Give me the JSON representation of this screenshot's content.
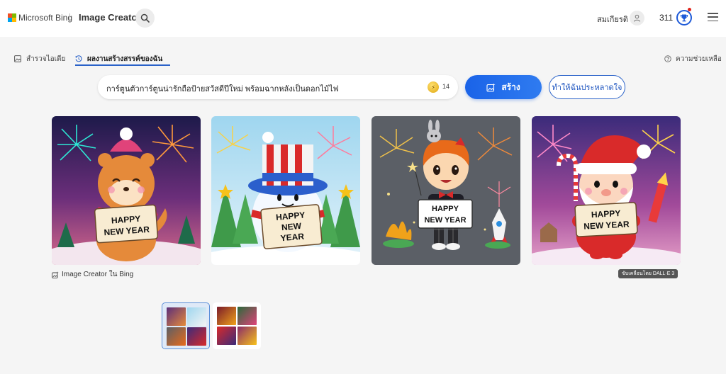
{
  "header": {
    "brand": "Microsoft Bing",
    "app_title": "Image Creator",
    "user_name": "สมเกียรติ",
    "points": "311"
  },
  "tabs": [
    {
      "label": "สำรวจไอเดีย",
      "icon": "image-icon",
      "active": false
    },
    {
      "label": "ผลงานสร้างสรรค์ของฉัน",
      "icon": "history-icon",
      "active": true
    }
  ],
  "help_label": "ความช่วยเหลือ",
  "prompt": {
    "value": "การ์ตูนตัวการ์ตูนน่ารักถือป้ายสวัสดีปีใหม่ พร้อมฉากหลังเป็นดอกไม้ไฟ",
    "boosts": "14"
  },
  "buttons": {
    "create_label": "สร้าง",
    "surprise_label": "ทำให้ฉันประหลาดใจ"
  },
  "images": [
    {
      "sign": [
        "HAPPY",
        "NEW YEAR"
      ],
      "subject": "fox-character"
    },
    {
      "sign": [
        "HAPPY",
        "NEW",
        "YEAR"
      ],
      "subject": "snowman-character"
    },
    {
      "sign": [
        "HAPPY",
        "NEW YEAR"
      ],
      "subject": "boy-with-bunny"
    },
    {
      "sign": [
        "HAPPY",
        "NEW YEAR"
      ],
      "subject": "santa-character"
    }
  ],
  "credit_label": "Image Creator ใน Bing",
  "dalle_label": "ขับเคลื่อนโดย DALL·E 3",
  "colors": {
    "accent": "#1a63e8",
    "header_bg": "#ffffff",
    "page_bg": "#f5f5f5"
  }
}
